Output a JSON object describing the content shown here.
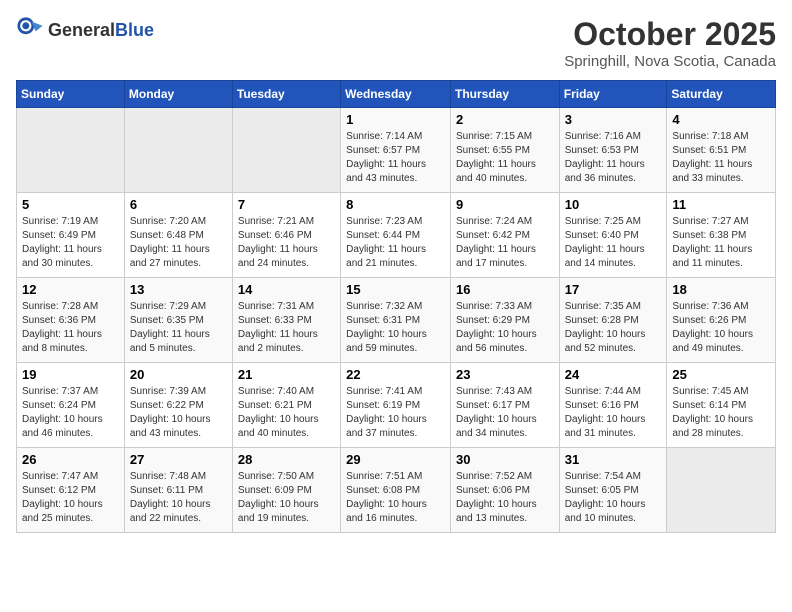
{
  "header": {
    "logo_general": "General",
    "logo_blue": "Blue",
    "title": "October 2025",
    "subtitle": "Springhill, Nova Scotia, Canada"
  },
  "days_of_week": [
    "Sunday",
    "Monday",
    "Tuesday",
    "Wednesday",
    "Thursday",
    "Friday",
    "Saturday"
  ],
  "weeks": [
    [
      {
        "day": "",
        "info": ""
      },
      {
        "day": "",
        "info": ""
      },
      {
        "day": "",
        "info": ""
      },
      {
        "day": "1",
        "info": "Sunrise: 7:14 AM\nSunset: 6:57 PM\nDaylight: 11 hours and 43 minutes."
      },
      {
        "day": "2",
        "info": "Sunrise: 7:15 AM\nSunset: 6:55 PM\nDaylight: 11 hours and 40 minutes."
      },
      {
        "day": "3",
        "info": "Sunrise: 7:16 AM\nSunset: 6:53 PM\nDaylight: 11 hours and 36 minutes."
      },
      {
        "day": "4",
        "info": "Sunrise: 7:18 AM\nSunset: 6:51 PM\nDaylight: 11 hours and 33 minutes."
      }
    ],
    [
      {
        "day": "5",
        "info": "Sunrise: 7:19 AM\nSunset: 6:49 PM\nDaylight: 11 hours and 30 minutes."
      },
      {
        "day": "6",
        "info": "Sunrise: 7:20 AM\nSunset: 6:48 PM\nDaylight: 11 hours and 27 minutes."
      },
      {
        "day": "7",
        "info": "Sunrise: 7:21 AM\nSunset: 6:46 PM\nDaylight: 11 hours and 24 minutes."
      },
      {
        "day": "8",
        "info": "Sunrise: 7:23 AM\nSunset: 6:44 PM\nDaylight: 11 hours and 21 minutes."
      },
      {
        "day": "9",
        "info": "Sunrise: 7:24 AM\nSunset: 6:42 PM\nDaylight: 11 hours and 17 minutes."
      },
      {
        "day": "10",
        "info": "Sunrise: 7:25 AM\nSunset: 6:40 PM\nDaylight: 11 hours and 14 minutes."
      },
      {
        "day": "11",
        "info": "Sunrise: 7:27 AM\nSunset: 6:38 PM\nDaylight: 11 hours and 11 minutes."
      }
    ],
    [
      {
        "day": "12",
        "info": "Sunrise: 7:28 AM\nSunset: 6:36 PM\nDaylight: 11 hours and 8 minutes."
      },
      {
        "day": "13",
        "info": "Sunrise: 7:29 AM\nSunset: 6:35 PM\nDaylight: 11 hours and 5 minutes."
      },
      {
        "day": "14",
        "info": "Sunrise: 7:31 AM\nSunset: 6:33 PM\nDaylight: 11 hours and 2 minutes."
      },
      {
        "day": "15",
        "info": "Sunrise: 7:32 AM\nSunset: 6:31 PM\nDaylight: 10 hours and 59 minutes."
      },
      {
        "day": "16",
        "info": "Sunrise: 7:33 AM\nSunset: 6:29 PM\nDaylight: 10 hours and 56 minutes."
      },
      {
        "day": "17",
        "info": "Sunrise: 7:35 AM\nSunset: 6:28 PM\nDaylight: 10 hours and 52 minutes."
      },
      {
        "day": "18",
        "info": "Sunrise: 7:36 AM\nSunset: 6:26 PM\nDaylight: 10 hours and 49 minutes."
      }
    ],
    [
      {
        "day": "19",
        "info": "Sunrise: 7:37 AM\nSunset: 6:24 PM\nDaylight: 10 hours and 46 minutes."
      },
      {
        "day": "20",
        "info": "Sunrise: 7:39 AM\nSunset: 6:22 PM\nDaylight: 10 hours and 43 minutes."
      },
      {
        "day": "21",
        "info": "Sunrise: 7:40 AM\nSunset: 6:21 PM\nDaylight: 10 hours and 40 minutes."
      },
      {
        "day": "22",
        "info": "Sunrise: 7:41 AM\nSunset: 6:19 PM\nDaylight: 10 hours and 37 minutes."
      },
      {
        "day": "23",
        "info": "Sunrise: 7:43 AM\nSunset: 6:17 PM\nDaylight: 10 hours and 34 minutes."
      },
      {
        "day": "24",
        "info": "Sunrise: 7:44 AM\nSunset: 6:16 PM\nDaylight: 10 hours and 31 minutes."
      },
      {
        "day": "25",
        "info": "Sunrise: 7:45 AM\nSunset: 6:14 PM\nDaylight: 10 hours and 28 minutes."
      }
    ],
    [
      {
        "day": "26",
        "info": "Sunrise: 7:47 AM\nSunset: 6:12 PM\nDaylight: 10 hours and 25 minutes."
      },
      {
        "day": "27",
        "info": "Sunrise: 7:48 AM\nSunset: 6:11 PM\nDaylight: 10 hours and 22 minutes."
      },
      {
        "day": "28",
        "info": "Sunrise: 7:50 AM\nSunset: 6:09 PM\nDaylight: 10 hours and 19 minutes."
      },
      {
        "day": "29",
        "info": "Sunrise: 7:51 AM\nSunset: 6:08 PM\nDaylight: 10 hours and 16 minutes."
      },
      {
        "day": "30",
        "info": "Sunrise: 7:52 AM\nSunset: 6:06 PM\nDaylight: 10 hours and 13 minutes."
      },
      {
        "day": "31",
        "info": "Sunrise: 7:54 AM\nSunset: 6:05 PM\nDaylight: 10 hours and 10 minutes."
      },
      {
        "day": "",
        "info": ""
      }
    ]
  ]
}
